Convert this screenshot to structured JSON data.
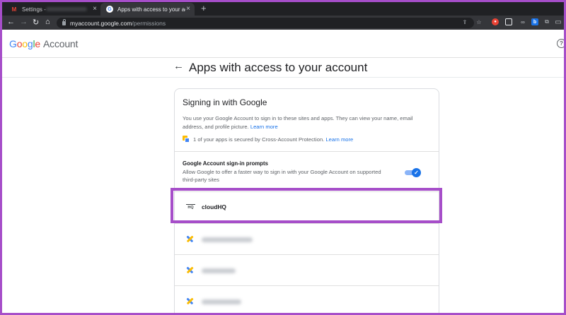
{
  "browser": {
    "tabs": [
      {
        "label": "Settings -",
        "favicon": "gmail-icon",
        "active": false
      },
      {
        "label": "Apps with access to your account",
        "favicon": "google-icon",
        "active": true
      }
    ],
    "new_tab": "+",
    "url_host": "myaccount.google.com",
    "url_path": "/permissions"
  },
  "header": {
    "logo_letters": [
      "G",
      "o",
      "o",
      "g",
      "l",
      "e"
    ],
    "logo_suffix": "Account",
    "help_glyph": "?"
  },
  "page": {
    "back_glyph": "←",
    "title": "Apps with access to your account"
  },
  "card": {
    "title": "Signing in with Google",
    "description": "You use your Google Account to sign in to these sites and apps. They can view your name, email address, and profile picture.",
    "learn_more": "Learn more",
    "cap_text": "1 of your apps is secured by Cross-Account Protection.",
    "cap_learn_more": "Learn more",
    "prompts_title": "Google Account sign-in prompts",
    "prompts_desc": "Allow Google to offer a faster way to sign in with your Google Account on supported third-party sites",
    "prompts_enabled": true
  },
  "apps": [
    {
      "name": "cloudHQ",
      "icon": "cloudhq-logo-icon",
      "highlighted": true
    },
    {
      "name": "",
      "icon": "pinwheel-icon",
      "blurred": true
    },
    {
      "name": "",
      "icon": "pinwheel-icon",
      "blurred": true
    },
    {
      "name": "",
      "icon": "pinwheel-icon",
      "blurred": true
    }
  ],
  "colors": {
    "highlight": "#a64ec9",
    "link": "#1a73e8",
    "toggle_on": "#1a73e8"
  }
}
